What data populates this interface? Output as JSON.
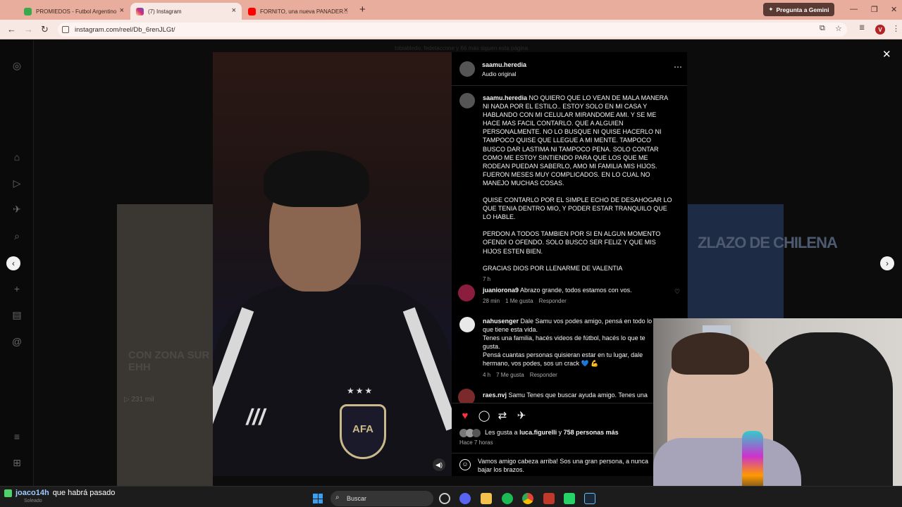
{
  "browser": {
    "tabs": [
      {
        "title": "PROMIEDOS - Futbol Argentino",
        "color": "#3aa94a"
      },
      {
        "title": "(7) Instagram",
        "color": "#d6249f"
      },
      {
        "title": "FORNITO, una nueva PANADER...",
        "color": "#ff0000"
      }
    ],
    "gemini_label": "Pregunta a Gemini",
    "url": "instagram.com/reel/Db_6renJLGt/",
    "profile_initial": "V"
  },
  "background": {
    "left_overlay_text": "CON ZONA SUR EHH",
    "left_views": "231 mil",
    "right_overlay_text": "ZLAZO DE CHILENA",
    "top_dim_text": "tobiabledo, fedetaccone y 66 más siguen esta página"
  },
  "video": {
    "crest_text": "AFA",
    "stars": "★★★"
  },
  "post": {
    "author": "saamu.heredia",
    "audio": "Audio original",
    "caption_paragraphs": [
      "NO QUIERO QUE LO VEAN DE MALA MANERA NI NADA POR EL ESTILO.. ESTOY SOLO EN MI CASA Y HABLANDO CON MI CELULAR MIRANDOME AMI. Y SE ME HACE MAS FACIL CONTARLO. QUE A ALGUIEN PERSONALMENTE. NO LO BUSQUE NI QUISE HACERLO NI TAMPOCO QUISE QUE LLEGUE A MI MENTE. TAMPOCO BUSCO DAR LASTIMA NI TAMPOCO PENA. SOLO CONTAR COMO ME ESTOY SINTIENDO PARA QUE LOS QUE ME RODEAN PUEDAN SABERLO, AMO MI FAMILIA MIS HIJOS. FUERON MESES MUY COMPLICADOS. EN LO CUAL NO MANEJO MUCHAS COSAS.",
      "QUISE CONTARLO POR EL SIMPLE ECHO DE DESAHOGAR LO QUE TENIA DENTRO MIO, Y PODER ESTAR TRANQUILO QUE LO HABLE.",
      "PERDON A TODOS TAMBIEN POR SI EN ALGUN MOMENTO OFENDI O OFENDO. SOLO BUSCO SER FELIZ Y QUE MIS HIJOS ESTEN BIEN.",
      "GRACIAS DIOS POR LLENARME DE VALENTIA"
    ],
    "caption_time": "7 h",
    "comments": [
      {
        "user": "juaniorona9",
        "text": "Abrazo grande, todos estamos con vos.",
        "time": "28 min",
        "likes": "1 Me gusta",
        "reply": "Responder"
      },
      {
        "user": "nahusenger",
        "text": "Dale Samu vos podes amigo, pensá en todo lo que tiene esta vida.\nTenes una familia, hacés videos de fútbol, hacés lo que te gusta.\nPensá cuantas personas quisieran estar en tu lugar, dale hermano, vos podes, sos un crack 💙 💪",
        "time": "4 h",
        "likes": "7 Me gusta",
        "reply": "Responder"
      },
      {
        "user": "raes.nvj",
        "text": "Samu Tenes que buscar ayuda amigo. Tenes una"
      }
    ],
    "likes_text_prefix": "Les gusta a",
    "likes_user": "luca.figurelli",
    "likes_text_mid": "y",
    "likes_count": "758 personas más",
    "posted_ago": "Hace 7 horas",
    "composer_text": "Vamos amigo cabeza arriba! Sos una gran persona, a nunca bajar los brazos."
  },
  "overlay": {
    "chat_user": "joaco14h",
    "chat_message": "que habrá pasado",
    "weather": "Soleado"
  },
  "taskbar": {
    "search_placeholder": "Buscar"
  },
  "colors": {
    "tab_strip": "#e8ad9d",
    "like_red": "#ff3040",
    "panel_bg": "#000000"
  }
}
